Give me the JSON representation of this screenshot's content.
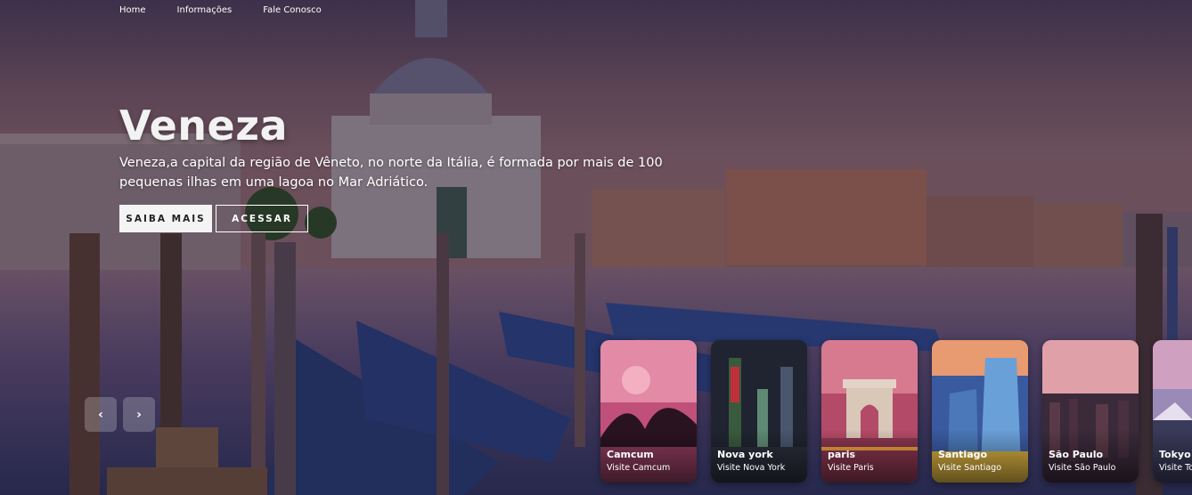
{
  "nav": {
    "items": [
      "Home",
      "Informações",
      "Fale Conosco"
    ]
  },
  "hero": {
    "title": "Veneza",
    "description": "Veneza,a capital da região de Vêneto, no norte da Itália, é formada por mais de 100 pequenas ilhas em uma lagoa no Mar Adriático.",
    "primary_button": "SAIBA MAIS",
    "secondary_button": "ACESSAR"
  },
  "slider": {
    "prev_icon": "chevron-left-icon",
    "next_icon": "chevron-right-icon",
    "prev_glyph": "‹",
    "next_glyph": "›"
  },
  "cards": [
    {
      "name": "Camcum",
      "subtitle": "Visite Camcum"
    },
    {
      "name": "Nova york",
      "subtitle": "Visite Nova York"
    },
    {
      "name": "paris",
      "subtitle": "Visite Paris"
    },
    {
      "name": "Santiago",
      "subtitle": "Visite Santiago"
    },
    {
      "name": "São Paulo",
      "subtitle": "Visite São Paulo"
    },
    {
      "name": "Tokyo",
      "subtitle": "Visite Tokyo"
    }
  ]
}
